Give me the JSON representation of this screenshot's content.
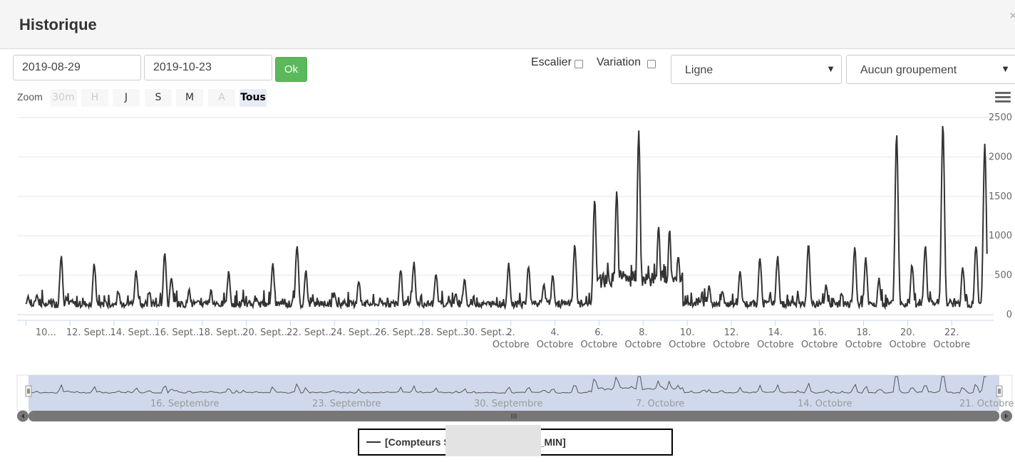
{
  "modal": {
    "title": "Historique",
    "close_label": "×"
  },
  "toolbar": {
    "start_date": "2019-08-29",
    "end_date": "2019-10-23",
    "ok_label": "Ok",
    "escalier_label": "Escalier",
    "variation_label": "Variation",
    "chart_type_value": "Ligne",
    "grouping_value": "Aucun groupement"
  },
  "zoom": {
    "label": "Zoom",
    "buttons": [
      {
        "label": "30m",
        "state": "disabled"
      },
      {
        "label": "H",
        "state": "disabled"
      },
      {
        "label": "J",
        "state": "normal"
      },
      {
        "label": "S",
        "state": "normal"
      },
      {
        "label": "M",
        "state": "normal"
      },
      {
        "label": "A",
        "state": "disabled"
      },
      {
        "label": "Tous",
        "state": "active"
      }
    ]
  },
  "legend": {
    "series_label": "[Compteurs                    STAT_CONSO_MOY_MIN]"
  },
  "chart_data": {
    "type": "line",
    "y_ticks": [
      "0",
      "500",
      "1000",
      "1500",
      "2000",
      "2500"
    ],
    "ylim": [
      0,
      2500
    ],
    "x_ticks_top": [
      "10...",
      "12. Sept...",
      "14. Sept...",
      "16. Sept...",
      "18. Sept...",
      "20. Sept...",
      "22. Sept...",
      "24. Sept...",
      "26. Sept...",
      "28. Sept...",
      "30. Sept...",
      "2.",
      "4.",
      "6.",
      "8.",
      "10.",
      "12.",
      "14.",
      "16.",
      "18.",
      "20.",
      "22."
    ],
    "x_ticks_bottom": [
      "",
      "",
      "",
      "",
      "",
      "",
      "",
      "",
      "",
      "",
      "",
      "Octobre",
      "Octobre",
      "Octobre",
      "Octobre",
      "Octobre",
      "Octobre",
      "Octobre",
      "Octobre",
      "Octobre",
      "Octobre",
      "Octobre"
    ],
    "navigator_labels": [
      "16. Septembre",
      "23. Septembre",
      "30. Septembre",
      "7. Octobre",
      "14. Octobre",
      "21. Octobre"
    ],
    "series_color": "#333333",
    "navigator_fill": "#c8d2e8",
    "peaks": [
      {
        "day": 10.1,
        "value": 210
      },
      {
        "day": 10.5,
        "value": 230
      },
      {
        "day": 11.6,
        "value": 720
      },
      {
        "day": 13.1,
        "value": 620
      },
      {
        "day": 14.2,
        "value": 260
      },
      {
        "day": 15.0,
        "value": 540
      },
      {
        "day": 15.6,
        "value": 280
      },
      {
        "day": 16.3,
        "value": 760
      },
      {
        "day": 16.6,
        "value": 460
      },
      {
        "day": 17.4,
        "value": 290
      },
      {
        "day": 18.4,
        "value": 280
      },
      {
        "day": 19.2,
        "value": 520
      },
      {
        "day": 21.2,
        "value": 620
      },
      {
        "day": 22.3,
        "value": 870
      },
      {
        "day": 22.7,
        "value": 530
      },
      {
        "day": 24.0,
        "value": 260
      },
      {
        "day": 25.1,
        "value": 410
      },
      {
        "day": 27.0,
        "value": 560
      },
      {
        "day": 27.6,
        "value": 640
      },
      {
        "day": 28.6,
        "value": 500
      },
      {
        "day": 29.5,
        "value": 260
      },
      {
        "day": 29.9,
        "value": 440
      },
      {
        "day": 31.9,
        "value": 620
      },
      {
        "day": 32.8,
        "value": 590
      },
      {
        "day": 33.5,
        "value": 380
      },
      {
        "day": 33.9,
        "value": 470
      },
      {
        "day": 34.9,
        "value": 860
      },
      {
        "day": 35.8,
        "value": 1450
      },
      {
        "day": 36.8,
        "value": 1550
      },
      {
        "day": 37.8,
        "value": 2300
      },
      {
        "day": 38.7,
        "value": 1120
      },
      {
        "day": 39.2,
        "value": 1050
      },
      {
        "day": 39.6,
        "value": 720
      },
      {
        "day": 41.0,
        "value": 340
      },
      {
        "day": 41.6,
        "value": 290
      },
      {
        "day": 42.4,
        "value": 530
      },
      {
        "day": 43.3,
        "value": 700
      },
      {
        "day": 44.1,
        "value": 720
      },
      {
        "day": 45.5,
        "value": 880
      },
      {
        "day": 46.3,
        "value": 360
      },
      {
        "day": 47.6,
        "value": 830
      },
      {
        "day": 48.1,
        "value": 690
      },
      {
        "day": 48.7,
        "value": 440
      },
      {
        "day": 49.5,
        "value": 2280
      },
      {
        "day": 50.2,
        "value": 610
      },
      {
        "day": 50.8,
        "value": 850
      },
      {
        "day": 51.6,
        "value": 2410
      },
      {
        "day": 52.5,
        "value": 580
      },
      {
        "day": 53.1,
        "value": 860
      },
      {
        "day": 53.5,
        "value": 2130
      }
    ]
  }
}
